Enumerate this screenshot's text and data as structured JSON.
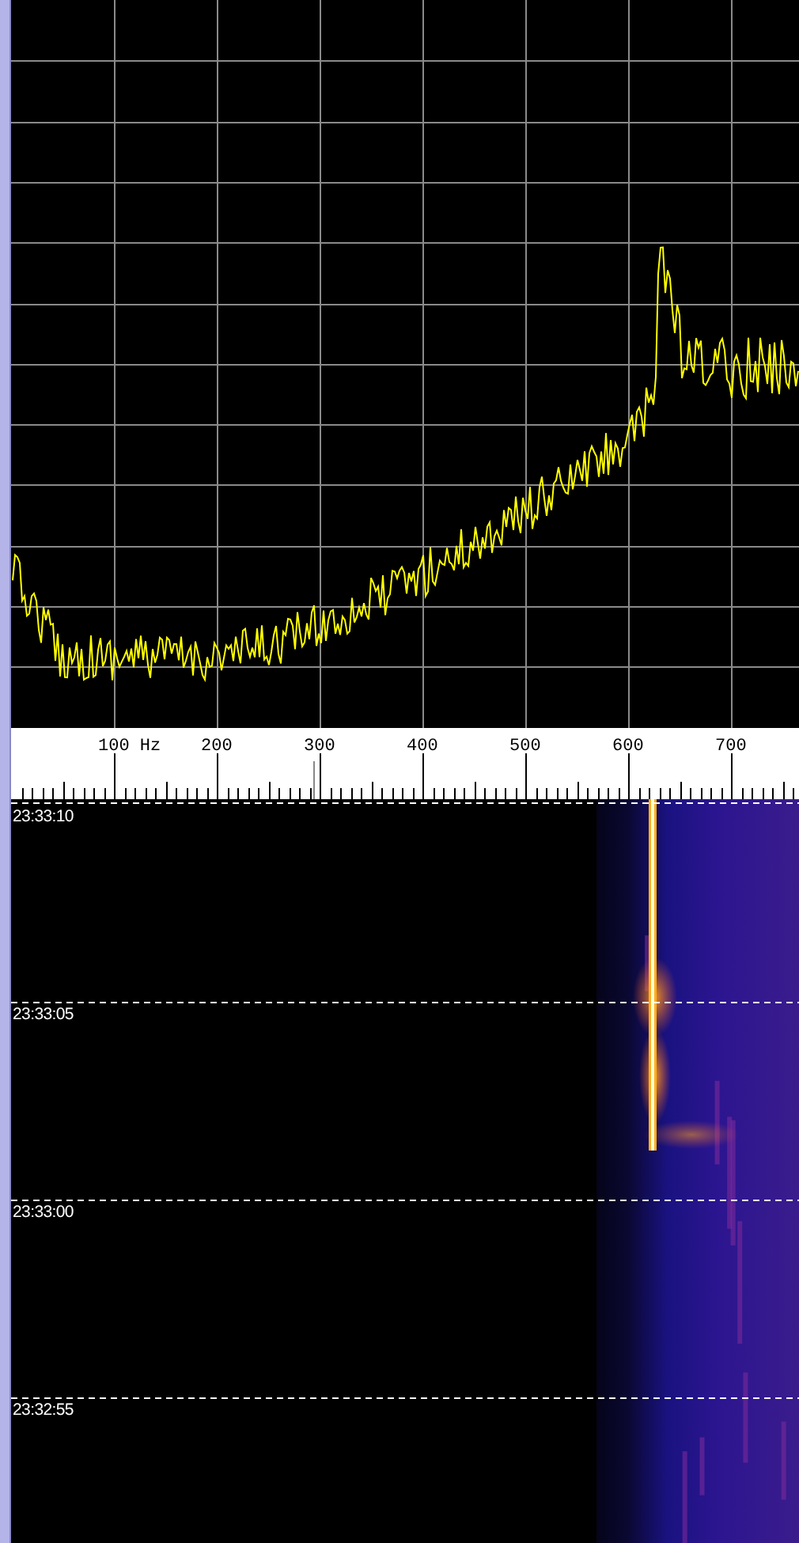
{
  "frequency_scale": {
    "labels": [
      "100 Hz",
      "200",
      "300",
      "400",
      "500",
      "600",
      "700"
    ]
  },
  "waterfall": {
    "timestamps": [
      "23:33:10",
      "23:33:05",
      "23:33:00",
      "23:32:55"
    ]
  }
}
